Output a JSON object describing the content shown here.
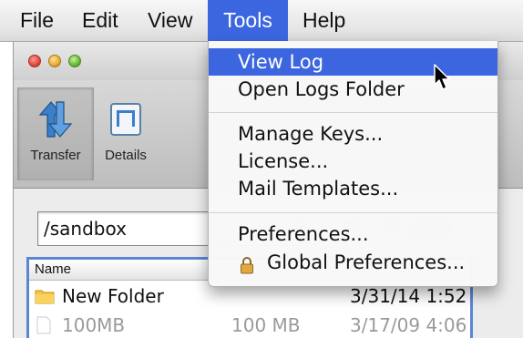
{
  "menubar": {
    "items": [
      {
        "label": "File"
      },
      {
        "label": "Edit"
      },
      {
        "label": "View"
      },
      {
        "label": "Tools"
      },
      {
        "label": "Help"
      }
    ],
    "active": "Tools",
    "highlight_color": "#3c66e0"
  },
  "window": {
    "toolbar": {
      "transfer_label": "Transfer",
      "details_label": "Details",
      "transfer_icon": "transfer-arrows-icon",
      "details_icon": "details-icon"
    },
    "path": {
      "value": "/sandbox"
    },
    "filelist": {
      "columns": [
        "Name"
      ],
      "rows": [
        {
          "name": "New Folder",
          "size": "",
          "date": "3/31/14 1:52",
          "icon": "folder-icon"
        },
        {
          "name": "100MB",
          "size": "100 MB",
          "date": "3/17/09 4:06",
          "icon": "file-icon"
        }
      ]
    }
  },
  "tools_menu": {
    "items": [
      {
        "label": "View Log"
      },
      {
        "label": "Open Logs Folder"
      },
      {
        "label": "Manage Keys..."
      },
      {
        "label": "License..."
      },
      {
        "label": "Mail Templates..."
      },
      {
        "label": "Preferences..."
      },
      {
        "label": "Global Preferences...",
        "icon": "lock-icon"
      }
    ],
    "highlighted": "View Log"
  }
}
